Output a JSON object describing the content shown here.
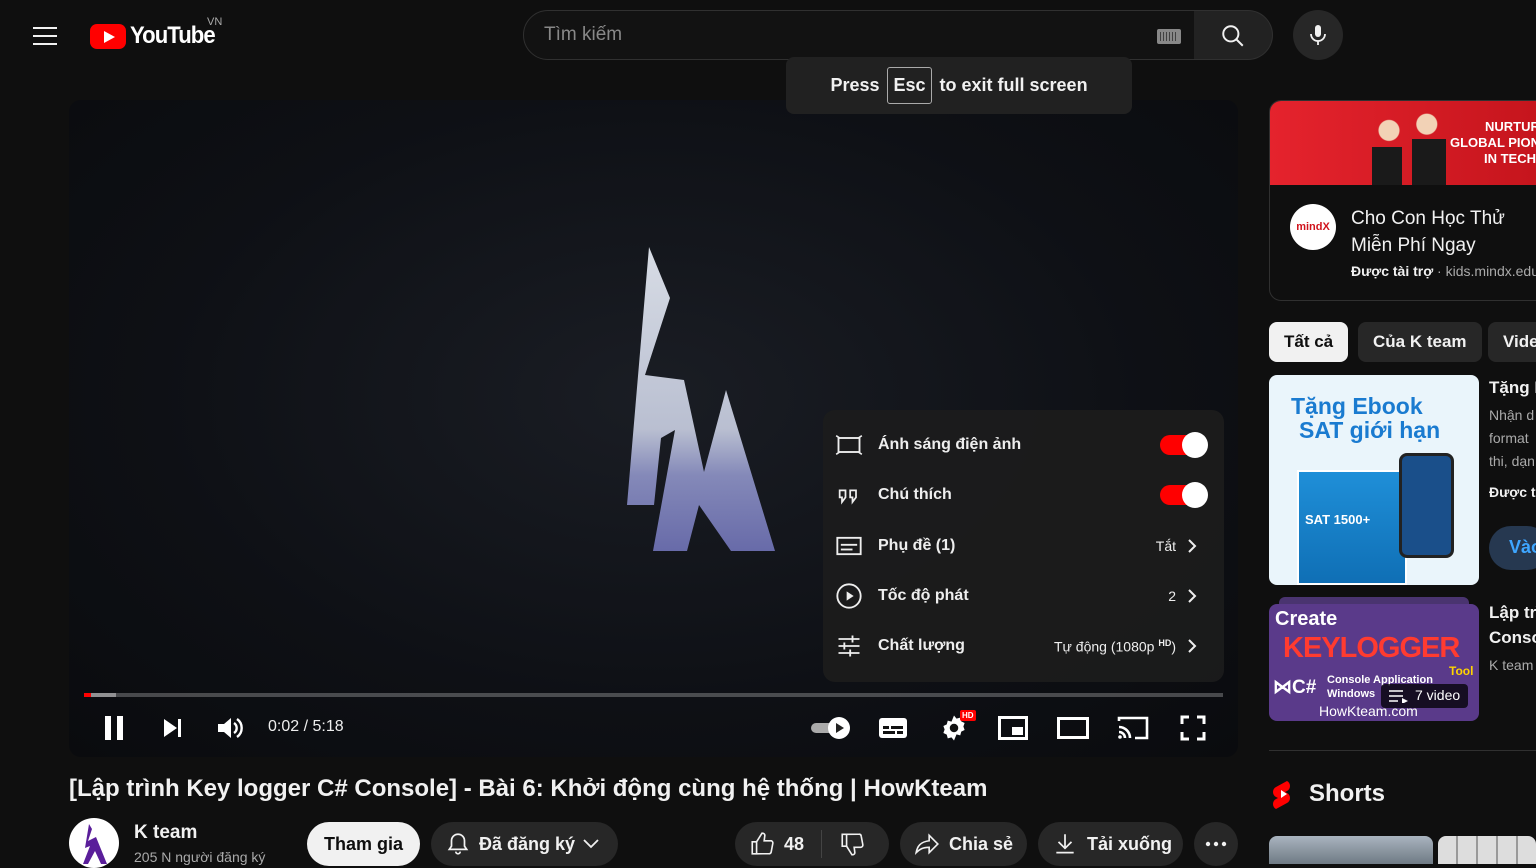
{
  "header": {
    "logo_text": "YouTube",
    "country": "VN",
    "search_placeholder": "Tìm kiếm"
  },
  "toast": {
    "press": "Press",
    "key": "Esc",
    "suffix": "to exit full screen"
  },
  "player": {
    "current_time": "0:02",
    "separator": " / ",
    "duration": "5:18",
    "progress_fraction": 0.006,
    "hd_badge": "HD",
    "settings": {
      "ambient_label": "Ánh sáng điện ảnh",
      "ambient_on": true,
      "annotations_label": "Chú thích",
      "annotations_on": true,
      "subtitles_label": "Phụ đề (1)",
      "subtitles_value": "Tắt",
      "speed_label": "Tốc độ phát",
      "speed_value": "2",
      "quality_label": "Chất lượng",
      "quality_value": "Tự động (1080p",
      "quality_sup": "HD",
      "quality_close": ")"
    }
  },
  "video": {
    "title": "[Lập trình Key logger C# Console] - Bài 6: Khởi động cùng hệ thống | HowKteam",
    "channel_name": "K team",
    "channel_subs": "205 N người đăng ký",
    "join_label": "Tham gia",
    "subscribed_label": "Đã đăng ký",
    "like_count": "48",
    "share_label": "Chia sẻ",
    "download_label": "Tải xuống"
  },
  "sidebar": {
    "ad": {
      "banner_line1": "NURTURING",
      "banner_line2": "GLOBAL PIONE",
      "banner_line3": "IN TECH",
      "brand": "mindX",
      "title": "Cho Con Học Thử Miễn Phí Ngay",
      "sponsored": "Được tài trợ",
      "domain": "kids.mindx.edu.vn"
    },
    "chips": [
      "Tất cả",
      "Của K team",
      "Video"
    ],
    "rec1": {
      "thumb_line1": "Tặng Ebook",
      "thumb_line2": "SAT giới hạn",
      "book_title": "SAT 1500+",
      "title": "Tặng E",
      "desc1": "Nhận d",
      "desc2": "format",
      "desc3": "thi, dạn",
      "sponsored": "Được t",
      "cta": "Vào"
    },
    "rec2": {
      "thumb_create": "Create",
      "thumb_keylogger": "KEYLOGGER",
      "thumb_tool": "Tool",
      "thumb_console": "Console Application",
      "thumb_windows": "Windows",
      "thumb_site": "HowKteam.com",
      "playlist_count": "7 video",
      "title1": "Lập trì",
      "title2": "Conso",
      "channel": "K team"
    },
    "shorts_title": "Shorts"
  },
  "colors": {
    "accent_red": "#ff0000",
    "background": "#0f0f0f",
    "chip_bg": "#272727"
  }
}
